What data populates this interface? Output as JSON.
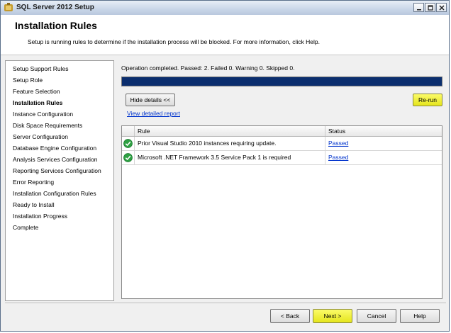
{
  "window": {
    "title": "SQL Server 2012 Setup",
    "controls": [
      "_",
      "□",
      "×"
    ]
  },
  "header": {
    "title": "Installation Rules",
    "subtitle": "Setup is running rules to determine if the installation process will be blocked. For more information, click Help."
  },
  "nav": {
    "items": [
      "Setup Support Rules",
      "Setup Role",
      "Feature Selection",
      "Installation Rules",
      "Instance Configuration",
      "Disk Space Requirements",
      "Server Configuration",
      "Database Engine Configuration",
      "Analysis Services Configuration",
      "Reporting Services Configuration",
      "Error Reporting",
      "Installation Configuration Rules",
      "Ready to Install",
      "Installation Progress",
      "Complete"
    ],
    "active_index": 3
  },
  "main": {
    "status": "Operation completed. Passed: 2.   Failed 0.   Warning 0.   Skipped 0.",
    "progress": 1.0,
    "hide_details_label": "Hide details <<",
    "rerun_label": "Re-run",
    "view_report_label": "View detailed report",
    "table": {
      "columns": [
        "Rule",
        "Status"
      ],
      "rows": [
        {
          "rule": "Prior Visual Studio 2010 instances requiring update.",
          "status": "Passed"
        },
        {
          "rule": "Microsoft .NET Framework 3.5 Service Pack 1 is required",
          "status": "Passed"
        }
      ]
    }
  },
  "footer": {
    "back_label": "< Back",
    "next_label": "Next >",
    "cancel_label": "Cancel",
    "help_label": "Help"
  },
  "colors": {
    "progress_fill": "#0b2e6e",
    "highlight": "#f0f02a",
    "pass_icon": "#2ea043"
  }
}
